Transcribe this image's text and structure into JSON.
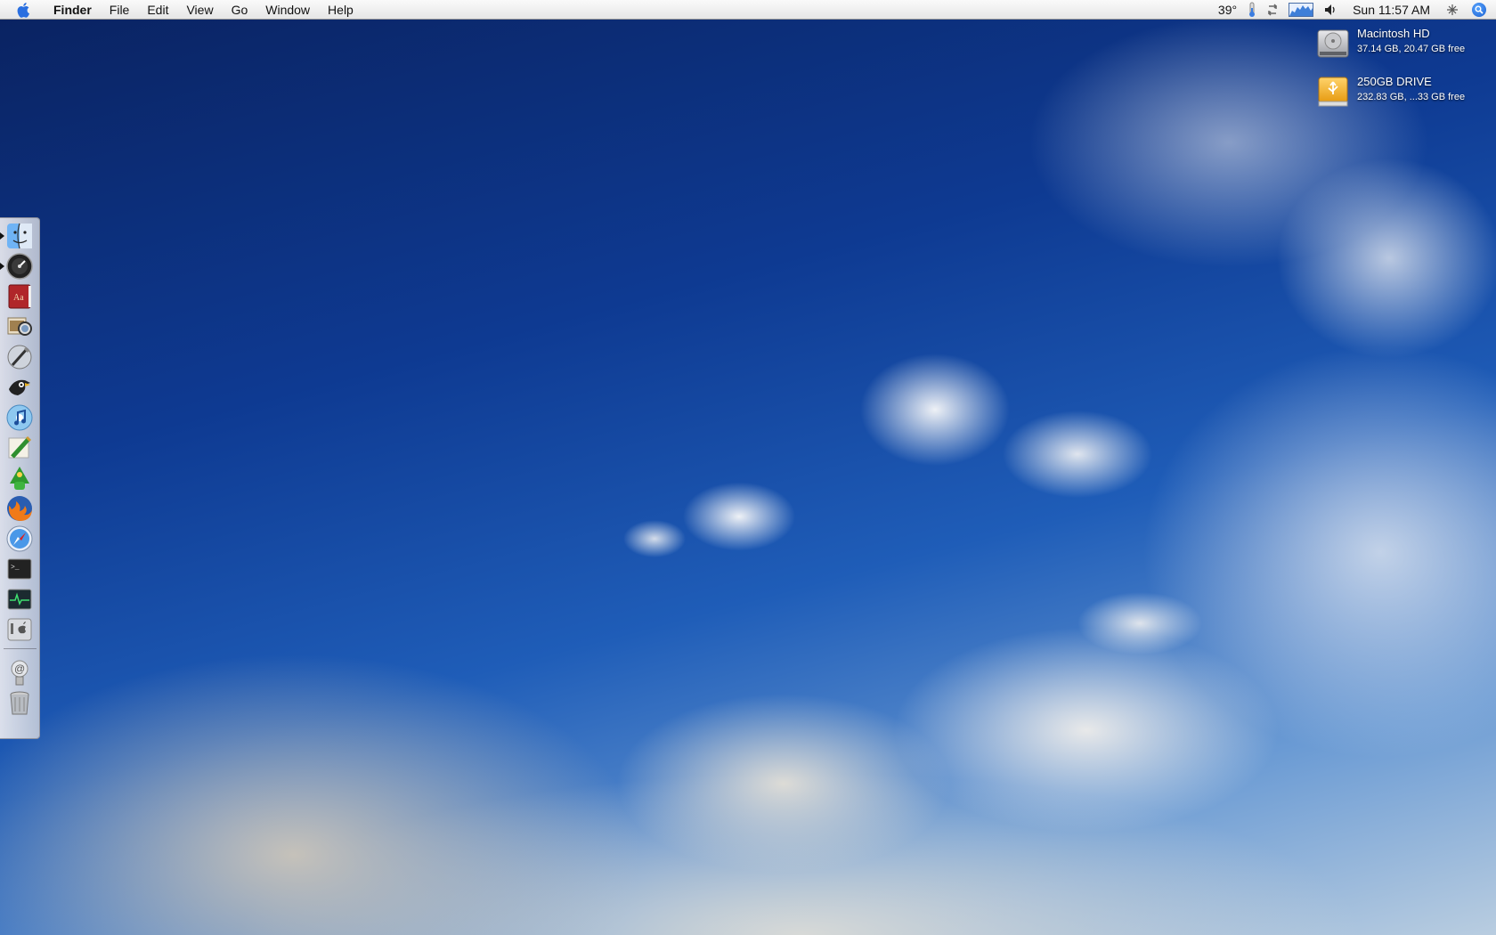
{
  "menubar": {
    "app_name": "Finder",
    "menus": [
      "File",
      "Edit",
      "View",
      "Go",
      "Window",
      "Help"
    ],
    "status": {
      "temperature": "39°",
      "clock": "Sun 11:57 AM"
    }
  },
  "desktop": {
    "drives": [
      {
        "name": "Macintosh HD",
        "info": "37.14 GB, 20.47 GB free",
        "icon": "hard-drive-icon"
      },
      {
        "name": "250GB DRIVE",
        "info": "232.83 GB, ...33 GB free",
        "icon": "usb-drive-icon"
      }
    ]
  },
  "dock": {
    "apps": [
      {
        "name": "finder",
        "running": true
      },
      {
        "name": "dashboard",
        "running": true
      },
      {
        "name": "dictionary",
        "running": false
      },
      {
        "name": "preview",
        "running": false
      },
      {
        "name": "script-editor",
        "running": false
      },
      {
        "name": "cyberduck",
        "running": false
      },
      {
        "name": "itunes",
        "running": false
      },
      {
        "name": "textmate",
        "running": false
      },
      {
        "name": "adium",
        "running": false
      },
      {
        "name": "firefox",
        "running": false
      },
      {
        "name": "safari",
        "running": false
      },
      {
        "name": "terminal",
        "running": false
      },
      {
        "name": "activity-monitor",
        "running": false
      },
      {
        "name": "system-preferences",
        "running": false
      }
    ],
    "stacks": [
      {
        "name": "mail-stack"
      },
      {
        "name": "trash"
      }
    ]
  },
  "colors": {
    "sky_top": "#0a2260",
    "sky_mid": "#1f5db8",
    "menubar_bg": "#f0f0f0",
    "spotlight_blue": "#1a5fd0"
  }
}
